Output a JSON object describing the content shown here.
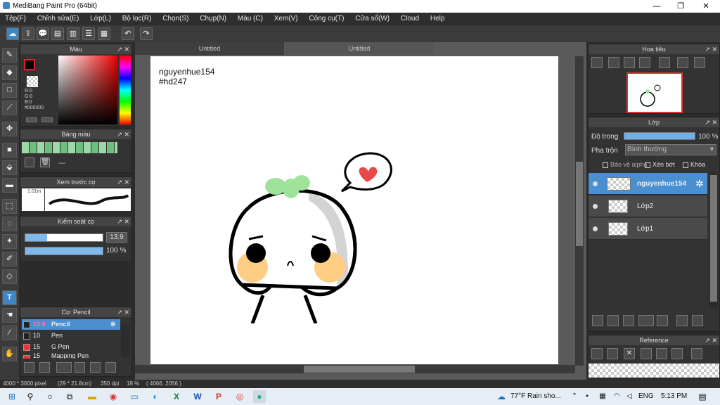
{
  "window": {
    "title": "MediBang Paint Pro (64bit)",
    "controls": [
      "—",
      "❐",
      "✕"
    ]
  },
  "menu": [
    "Tệp(F)",
    "Chỉnh sửa(E)",
    "Lớp(L)",
    "Bộ lọc(R)",
    "Chọn(S)",
    "Chụp(N)",
    "Màu (C)",
    "Xem(V)",
    "Công cụ(T)",
    "Cửa sổ(W)",
    "Cloud",
    "Help"
  ],
  "panels": {
    "color": {
      "title": "Màu",
      "r": "R:0",
      "g": "G:0",
      "b": "B:0",
      "hex": "#000000"
    },
    "palette": {
      "title": "Bảng màu",
      "selected": "---"
    },
    "brush_preview": {
      "title": "Xem trước cọ",
      "size": "1.01m"
    },
    "brush_control": {
      "title": "Kiểm soát cọ",
      "size_value": "13.9",
      "opacity_value": "100 %",
      "opacity_fraction": 1.0
    },
    "brushes": {
      "title": "Cọ: Pencil",
      "items": [
        {
          "size": "13.9",
          "name": "Pencil",
          "selected": true
        },
        {
          "size": "10",
          "name": "Pen",
          "selected": false
        },
        {
          "size": "15",
          "name": "G Pen",
          "selected": false
        },
        {
          "size": "15",
          "name": "Mapping Pen",
          "selected": false
        }
      ]
    },
    "navigator": {
      "title": "Hoa tiêu"
    },
    "layers": {
      "title": "Lớp",
      "opacity_label": "Độ trong",
      "opacity_value": "100 %",
      "blend_label": "Pha trộn",
      "blend_value": "Bình thường",
      "protect_alpha": "Bảo vệ alpha",
      "clipping": "Xén bớt",
      "lock": "Khóa",
      "items": [
        {
          "name": "nguyenhue154",
          "selected": true
        },
        {
          "name": "Lớp2",
          "selected": false
        },
        {
          "name": "Lớp1",
          "selected": false
        }
      ]
    },
    "reference": {
      "title": "Reference"
    }
  },
  "tabs": [
    {
      "label": "Untitled",
      "selected": false
    },
    {
      "label": "Untitled",
      "selected": true
    }
  ],
  "canvas_text": {
    "line1": "nguyenhue154",
    "line2": "#hd247"
  },
  "status": {
    "size": "4000 * 3000 pixel",
    "print": "(29 * 21.8cm)",
    "dpi": "350 dpi",
    "zoom": "18 %",
    "coords": "( 4066, 2056 )"
  },
  "taskbar": {
    "weather": "77°F  Rain sho...",
    "lang": "ENG",
    "time": "5:13 PM"
  },
  "colors": {
    "accent": "#3d86c6",
    "bg": "#2b2b2b",
    "brush_selected": "#4a8fd0"
  }
}
